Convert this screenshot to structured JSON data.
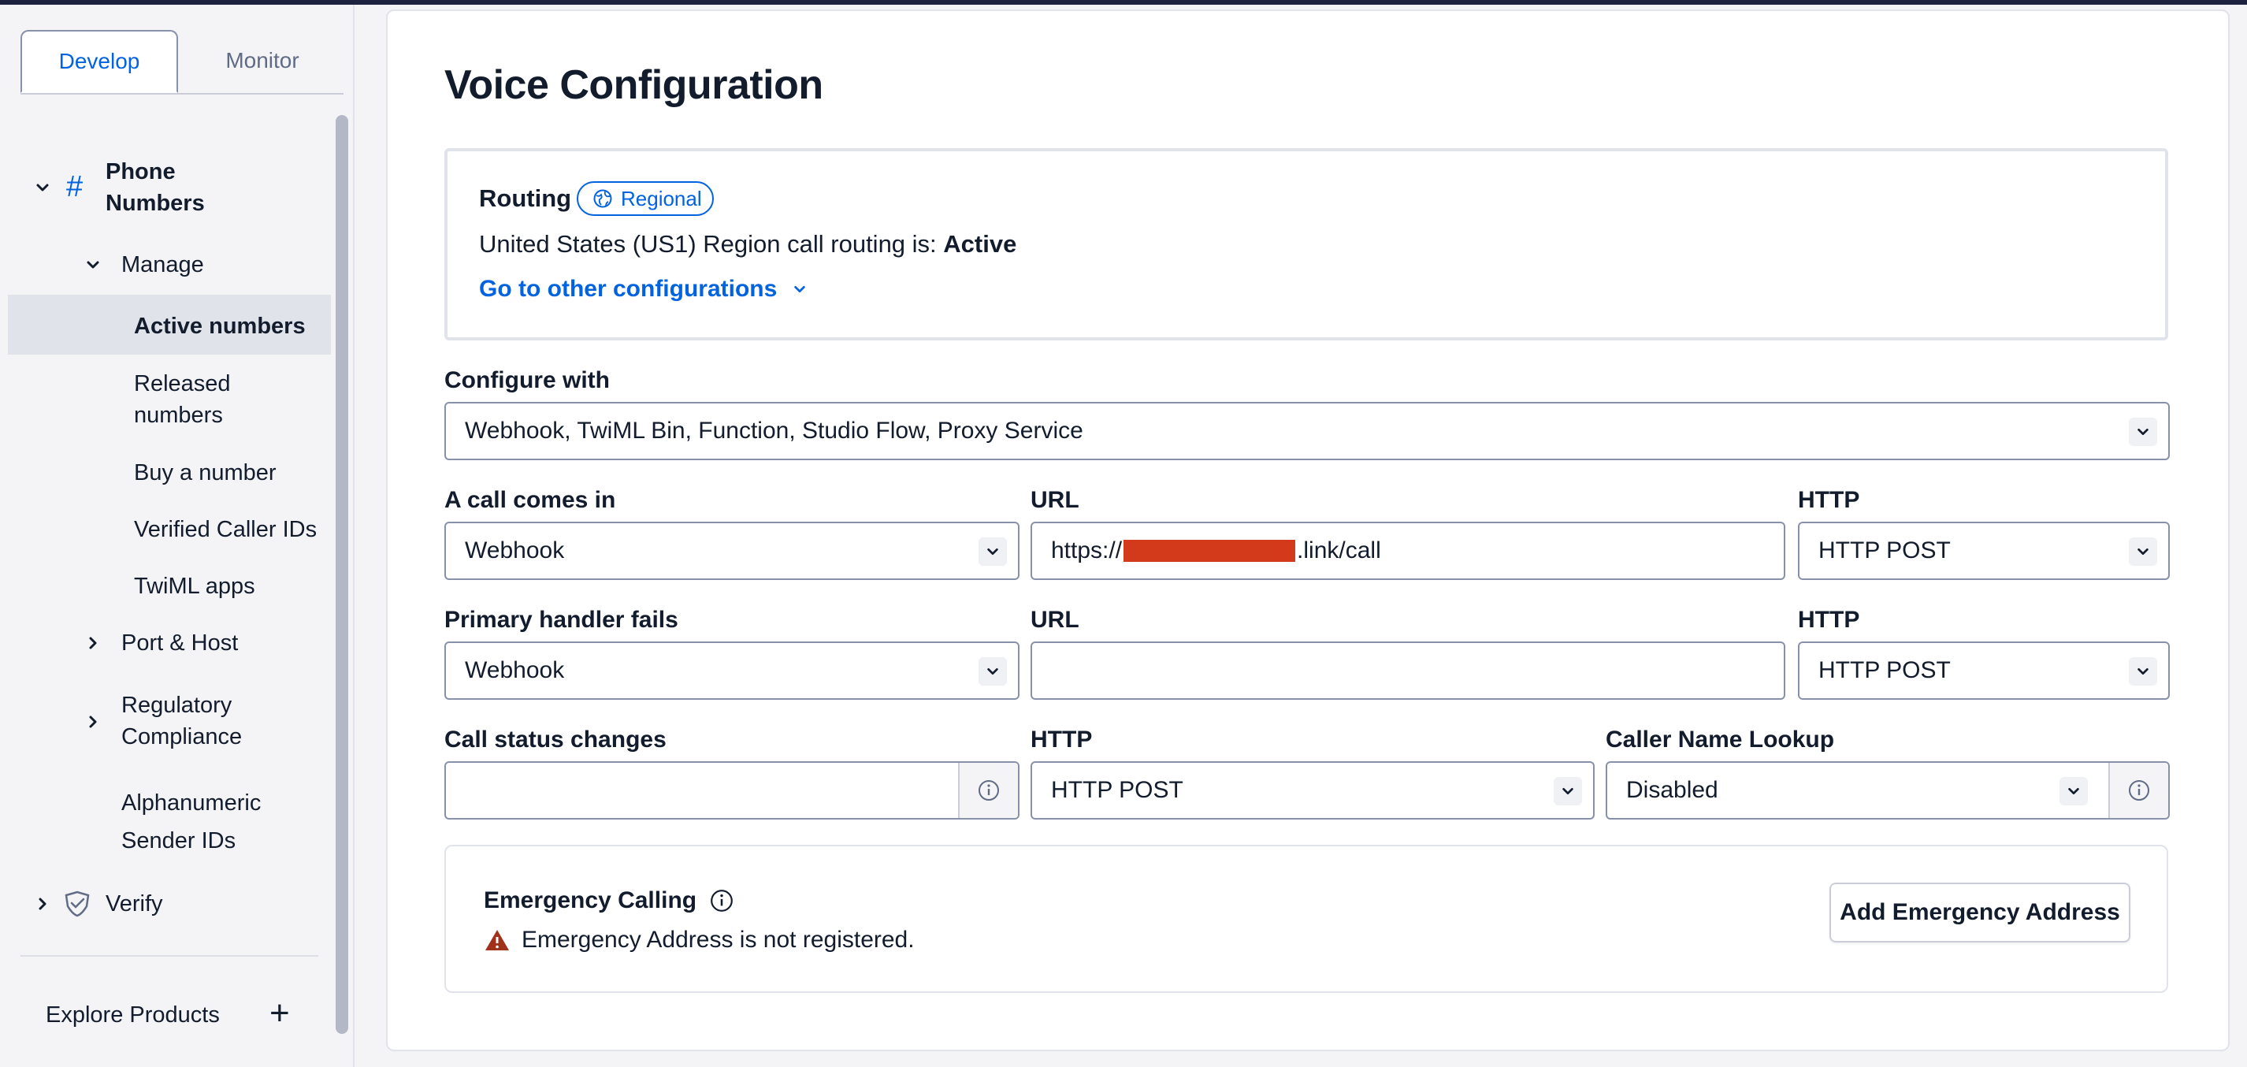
{
  "sidebar": {
    "tabs": [
      {
        "label": "Develop"
      },
      {
        "label": "Monitor"
      }
    ],
    "phone_numbers": {
      "icon": "hash-icon",
      "label_line1": "Phone",
      "label_line2": "Numbers"
    },
    "manage": "Manage",
    "items": [
      {
        "label": "Active numbers"
      },
      {
        "label_line1": "Released",
        "label_line2": "numbers"
      },
      {
        "label": "Buy a number"
      },
      {
        "label": "Verified Caller IDs"
      },
      {
        "label": "TwiML apps"
      }
    ],
    "port_host": "Port & Host",
    "regulatory": {
      "line1": "Regulatory",
      "line2": "Compliance"
    },
    "alphanumeric": {
      "line1": "Alphanumeric",
      "line2": "Sender IDs"
    },
    "verify": "Verify",
    "explore": "Explore Products",
    "explore_icon": "+"
  },
  "main": {
    "title": "Voice Configuration",
    "routing": {
      "label": "Routing",
      "badge": "Regional",
      "line_prefix": "United States (US1) Region call routing is: ",
      "line_status": "Active",
      "link": "Go to other configurations"
    },
    "configure_with": {
      "label": "Configure with",
      "value": "Webhook, TwiML Bin, Function, Studio Flow, Proxy Service"
    },
    "call_comes_in": {
      "label": "A call comes in",
      "value": "Webhook",
      "url_label": "URL",
      "url_prefix": "https://",
      "url_suffix": ".link/call",
      "http_label": "HTTP",
      "http_value": "HTTP POST"
    },
    "primary_handler": {
      "label": "Primary handler fails",
      "value": "Webhook",
      "url_label": "URL",
      "url_value": "",
      "http_label": "HTTP",
      "http_value": "HTTP POST"
    },
    "status_changes": {
      "label": "Call status changes",
      "value": "",
      "http_label": "HTTP",
      "http_value": "HTTP POST",
      "lookup_label": "Caller Name Lookup",
      "lookup_value": "Disabled"
    },
    "emergency": {
      "title": "Emergency Calling",
      "warning": "Emergency Address is not registered.",
      "button": "Add Emergency Address"
    }
  },
  "colors": {
    "accent": "#0263e0",
    "text": "#121c2d",
    "warning": "#a0321c",
    "redaction": "#d3391b"
  }
}
